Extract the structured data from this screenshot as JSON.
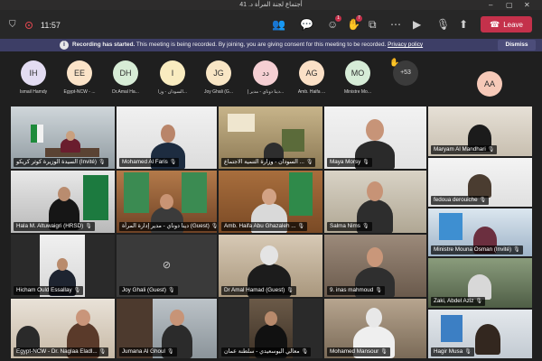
{
  "window": {
    "title": "أجتماع لجنة المرأة د. 41"
  },
  "toolbar": {
    "timer": "11:57",
    "leave_label": "Leave",
    "reactions_badge": "1",
    "chat_badge": "7"
  },
  "banner": {
    "bold_text": "Recording has started.",
    "text": " This meeting is being recorded. By joining, you are giving consent for this meeting to be recorded. ",
    "link": "Privacy policy",
    "dismiss_label": "Dismiss"
  },
  "participants": [
    {
      "initials": "IH",
      "name": "Ismail Hamdy",
      "color": "#e3dcf2"
    },
    {
      "initials": "EE",
      "name": "Egypt-NCW - ...",
      "color": "#fbe3c8"
    },
    {
      "initials": "DH",
      "name": "Dr.Amal Ha...",
      "color": "#d7ecd6"
    },
    {
      "initials": "I",
      "name": "السودان - وزا...",
      "color": "#f9ecc0"
    },
    {
      "initials": "JG",
      "name": "Joy Ghali (G...",
      "color": "#f9e6c5"
    },
    {
      "initials": "دد",
      "name": "دينا دوناي - مدير إ...",
      "color": "#f5cfd3"
    },
    {
      "initials": "AG",
      "name": "Amb. Haifa ...",
      "color": "#fbe0c6"
    },
    {
      "initials": "MO",
      "name": "Ministre Mo...",
      "color": "#d6ecd7"
    }
  ],
  "overflow_count": "+53",
  "self_initials": "AA",
  "colors": {
    "leave": "#c4314b",
    "banner": "#3d3e66",
    "accent": "#6264a7"
  },
  "tiles": [
    {
      "name": "السيدة الوزيرة كوثر كريكو (Invité)"
    },
    {
      "name": "Mohamed Al Faris"
    },
    {
      "name": "السودان - وزارة التنمية الاجتماع ..."
    },
    {
      "name": "Maya Morsy"
    },
    {
      "name": "Maryam Al Mandhari"
    },
    {
      "name": "Hala M. Altuwaigri (HRSD)"
    },
    {
      "name": "دينا دوناي - مدير إدارة المرأة (Guest)"
    },
    {
      "name": "Amb. Haifa Abu Ghazaleh ..."
    },
    {
      "name": "Salma Nims"
    },
    {
      "name": "fedoua derouiche"
    },
    {
      "name": "Ministre Mouna Osman (Invité)"
    },
    {
      "name": "Hicham Ould Essallay"
    },
    {
      "name": "Joy Ghali (Guest)"
    },
    {
      "name": "Dr Amal Hamad (Guest)"
    },
    {
      "name": "9. inas mahmoud"
    },
    {
      "name": "Zaki, Abdel Aziz"
    },
    {
      "name": "Egypt-NCW - Dr. Naglaa Eladl..."
    },
    {
      "name": "Jumana Al Ghoul"
    },
    {
      "name": "معالي اليوسعيدي - سلطنة عمان"
    },
    {
      "name": "Mohamed Mansour"
    },
    {
      "name": "Hagir Musa"
    }
  ]
}
